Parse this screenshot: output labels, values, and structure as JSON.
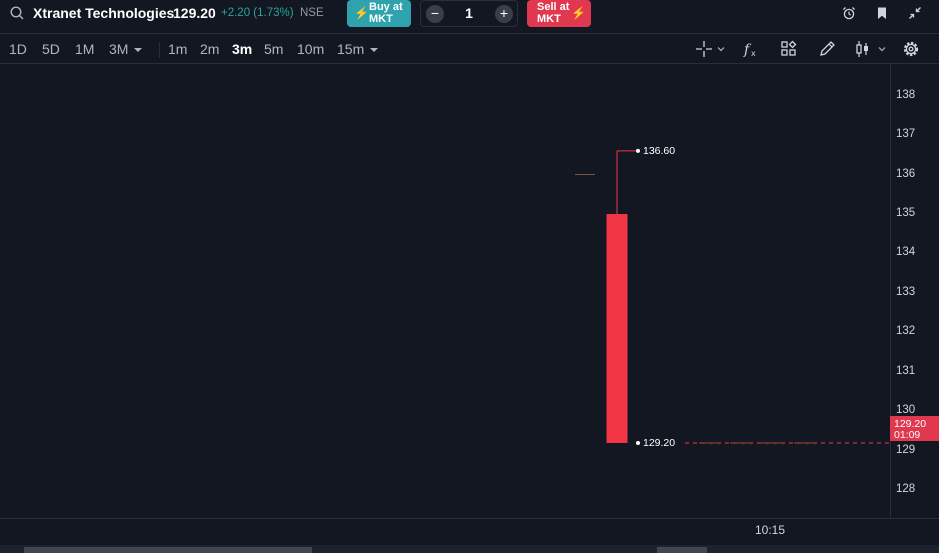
{
  "header": {
    "symbol_name": "Xtranet Technologies",
    "price": "129.20",
    "change": "+2.20 (1.73%)",
    "exchange": "NSE",
    "buy_label": "Buy at\nMKT",
    "sell_label": "Sell at\nMKT",
    "quantity": "1",
    "colors": {
      "buy": "#2ea3ad",
      "sell": "#e0394f",
      "positive": "#26a69a"
    }
  },
  "toolbar": {
    "ranges": [
      "1D",
      "5D",
      "1M",
      "3M"
    ],
    "intervals": [
      "1m",
      "2m",
      "3m",
      "5m",
      "10m",
      "15m"
    ],
    "active_interval": "3m",
    "right_icons": [
      "crosshair-icon",
      "indicators-fx-icon",
      "templates-icon",
      "drawing-pencil-icon",
      "candle-type-icon",
      "settings-gear-icon"
    ]
  },
  "price_axis": {
    "labels": [
      "138",
      "137",
      "136",
      "135",
      "134",
      "133",
      "132",
      "131",
      "130",
      "129",
      "128"
    ],
    "current_price": "129.20",
    "countdown": "01:09"
  },
  "time_axis": {
    "label": "10:15"
  },
  "annotations": {
    "high": "136.60",
    "low": "129.20"
  },
  "chart_data": {
    "type": "candlestick",
    "y_range": [
      127.3,
      138.8
    ],
    "candles": [
      {
        "open": 136.0,
        "high": 136.0,
        "low": 136.0,
        "close": 136.0
      },
      {
        "open": 135.0,
        "high": 136.6,
        "low": 129.2,
        "close": 129.2
      },
      {
        "open": 129.2,
        "high": 129.2,
        "low": 129.2,
        "close": 129.2
      },
      {
        "open": 129.2,
        "high": 129.2,
        "low": 129.2,
        "close": 129.2
      },
      {
        "open": 129.2,
        "high": 129.2,
        "low": 129.2,
        "close": 129.2
      },
      {
        "open": 129.2,
        "high": 129.2,
        "low": 129.2,
        "close": 129.2
      }
    ],
    "last_price": 129.2,
    "colors": {
      "down": "#f23645",
      "up": "#26a69a",
      "last_price_line": "#f23645"
    }
  }
}
